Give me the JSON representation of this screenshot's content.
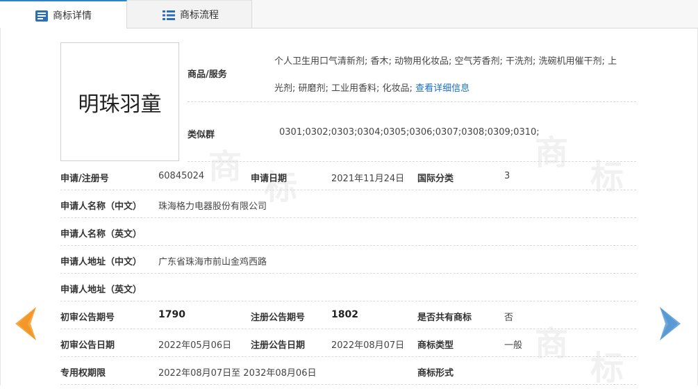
{
  "tabs": [
    {
      "label": "商标详情"
    },
    {
      "label": "商标流程"
    }
  ],
  "logo_text": "明珠羽童",
  "watermark_char_1": "商",
  "watermark_char_2": "标",
  "goods": {
    "label": "商品/服务",
    "line1": "个人卫生用口气清新剂; 香木; 动物用化妆品; 空气芳香剂; 干洗剂; 洗碗机用催干剂; 上",
    "line2": "光剂; 研磨剂; 工业用香料; 化妆品;",
    "link": "查看详细信息"
  },
  "similar": {
    "label": "类似群",
    "value": "0301;0302;0303;0304;0305;0306;0307;0308;0309;0310;"
  },
  "rows": {
    "reg_no_label": "申请/注册号",
    "reg_no": "60845024",
    "app_date_label": "申请日期",
    "app_date": "2021年11月24日",
    "intl_class_label": "国际分类",
    "intl_class": "3",
    "applicant_cn_label": "申请人名称（中文）",
    "applicant_cn": "珠海格力电器股份有限公司",
    "applicant_en_label": "申请人名称（英文）",
    "address_cn_label": "申请人地址（中文）",
    "address_cn": "广东省珠海市前山金鸡西路",
    "address_en_label": "申请人地址（英文）",
    "prelim_no_label": "初审公告期号",
    "prelim_no": "1790",
    "reg_pub_no_label": "注册公告期号",
    "reg_pub_no": "1802",
    "shared_label": "是否共有商标",
    "shared": "否",
    "prelim_date_label": "初审公告日期",
    "prelim_date": "2022年05月06日",
    "reg_pub_date_label": "注册公告日期",
    "reg_pub_date": "2022年08月07日",
    "tm_type_label": "商标类型",
    "tm_type": "一般",
    "exclusive_label": "专用权期限",
    "exclusive": "2022年08月07日至 2032年08月06日",
    "tm_form_label": "商标形式"
  },
  "colors": {
    "prev_arrow": "#f08c1a",
    "next_arrow": "#5a9bd5",
    "tab_accent": "#2d83c8",
    "link": "#1a6fc4"
  }
}
